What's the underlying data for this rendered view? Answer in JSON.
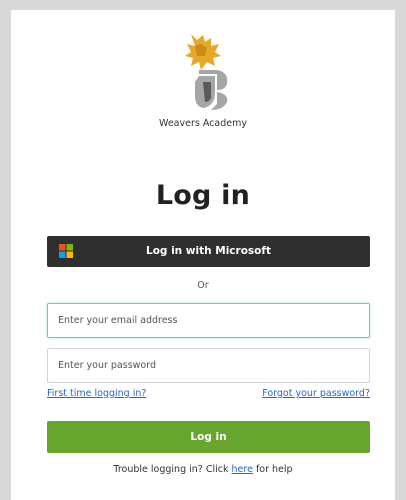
{
  "brand": {
    "name": "Weavers Academy",
    "logo_icon": "weavers-academy-crest-icon",
    "logo_colors": {
      "gold": "#e5a82a",
      "grey": "#a6a6a6",
      "dark": "#5a5a5a"
    }
  },
  "title": "Log in",
  "microsoft": {
    "label": "Log in with Microsoft",
    "icon": "microsoft-logo-icon",
    "colors": {
      "red": "#f25022",
      "green": "#7fba00",
      "blue": "#00a4ef",
      "yellow": "#ffb900",
      "background": "#2f2f2f"
    }
  },
  "divider": "Or",
  "email": {
    "placeholder": "Enter your email address",
    "value": ""
  },
  "password": {
    "placeholder": "Enter your password",
    "value": ""
  },
  "links": {
    "first_time": "First time logging in?",
    "forgot": "Forgot your password?"
  },
  "login_button": {
    "label": "Log in",
    "color": "#67a52f"
  },
  "help": {
    "prefix": "Trouble logging in? Click ",
    "link": "here",
    "suffix": " for help"
  }
}
